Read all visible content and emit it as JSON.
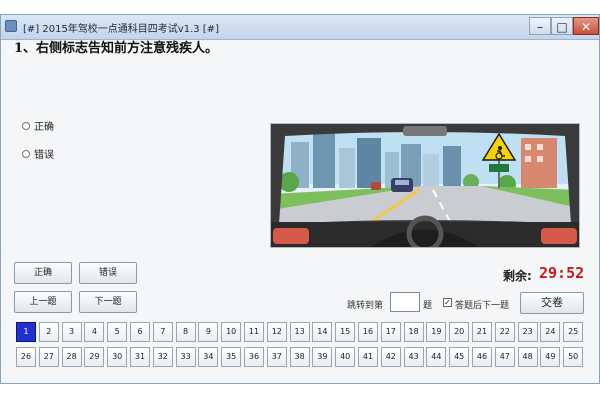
{
  "window": {
    "title": "[#] 2015年驾校一点通科目四考试v1.3 [#]",
    "controls": {
      "minimize": "–",
      "maximize": "□",
      "close": "✕"
    }
  },
  "question": {
    "text": "1、右侧标志告知前方注意残疾人。"
  },
  "options": [
    {
      "label": "正确"
    },
    {
      "label": "错误"
    }
  ],
  "buttons": {
    "correct": "正确",
    "wrong": "错误",
    "prev": "上一题",
    "next": "下一题",
    "submit": "交卷"
  },
  "timer": {
    "label": "剩余:",
    "value": "29:52"
  },
  "jump": {
    "label": "跳转到第",
    "unit": "题",
    "value": ""
  },
  "auto_next": {
    "label": "答题后下一题",
    "checked": true
  },
  "question_numbers": {
    "current": 1,
    "items": [
      "1",
      "2",
      "3",
      "4",
      "5",
      "6",
      "7",
      "8",
      "9",
      "10",
      "11",
      "12",
      "13",
      "14",
      "15",
      "16",
      "17",
      "18",
      "19",
      "20",
      "21",
      "22",
      "23",
      "24",
      "25",
      "26",
      "27",
      "28",
      "29",
      "30",
      "31",
      "32",
      "33",
      "34",
      "35",
      "36",
      "37",
      "38",
      "39",
      "40",
      "41",
      "42",
      "43",
      "44",
      "45",
      "46",
      "47",
      "48",
      "49",
      "50"
    ]
  },
  "colors": {
    "accent": "#1f2fd0",
    "timer": "#c41a1a"
  },
  "icons": {
    "app": "app-icon",
    "road_sign": "disabled-person-sign-icon"
  }
}
